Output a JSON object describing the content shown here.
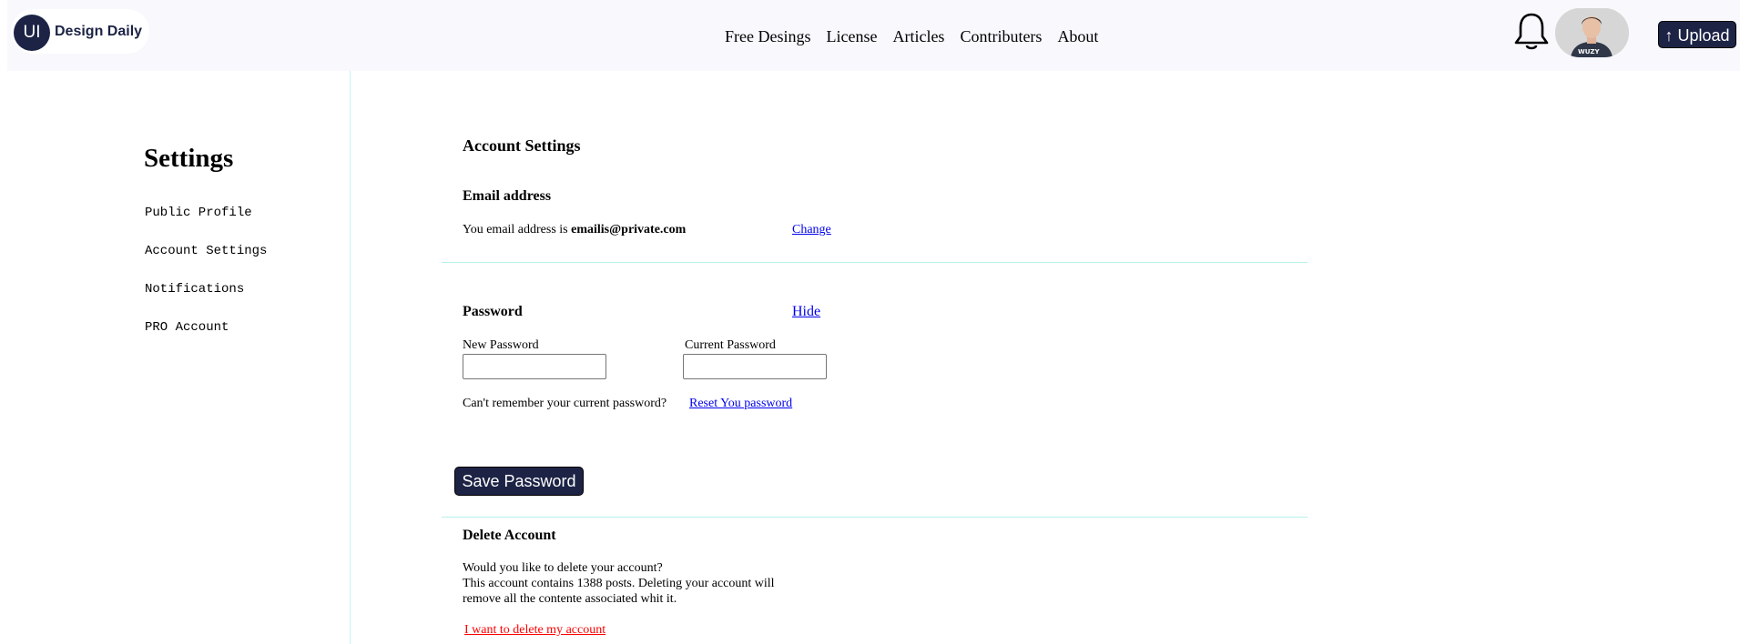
{
  "header": {
    "logo_mark": "UI",
    "logo_text": "Design Daily",
    "nav": [
      "Free Desings",
      "License",
      "Articles",
      "Contributers",
      "About"
    ],
    "bell_icon": "bell-icon",
    "avatar_icon": "user-avatar",
    "upload_arrow": "↑",
    "upload_label": "Upload"
  },
  "sidebar": {
    "title": "Settings",
    "items": [
      "Public Profile",
      "Account Settings",
      "Notifications",
      "PRO Account"
    ]
  },
  "main": {
    "title": "Account Settings",
    "email": {
      "heading": "Email address",
      "prefix": "You email address is ",
      "address": "emailis@private.com",
      "change_link": "Change"
    },
    "password": {
      "heading": "Password",
      "hide_link": "Hide",
      "new_label": "New Password",
      "new_value": "",
      "current_label": "Current Password",
      "current_value": "",
      "forgot_text": "Can't remember your current password?",
      "reset_link": "Reset You password",
      "save_label": "Save Password"
    },
    "delete": {
      "heading": "Delete Account",
      "line1": "Would you like to delete your account?",
      "line2": "This account contains 1388 posts. Deleting your account will",
      "line3": "remove all the contente associated whit it.",
      "link": "I want to delete my account"
    }
  },
  "colors": {
    "brand_navy": "#1c2345",
    "header_bg": "#f8f8fd",
    "divider": "#b6f1ea",
    "link": "#0000ee",
    "danger": "#ff0000"
  }
}
